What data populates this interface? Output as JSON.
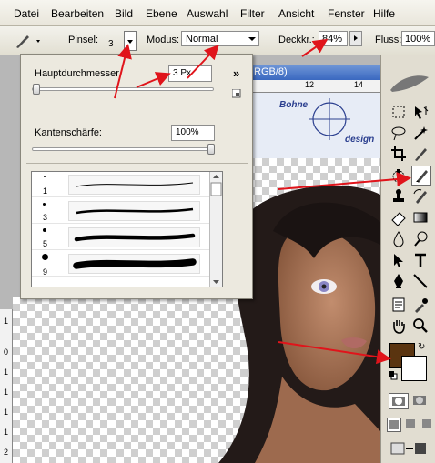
{
  "menu": [
    "Datei",
    "Bearbeiten",
    "Bild",
    "Ebene",
    "Auswahl",
    "Filter",
    "Ansicht",
    "Fenster",
    "Hilfe"
  ],
  "options": {
    "brush_label": "Pinsel:",
    "brush_size": "3",
    "mode_label": "Modus:",
    "mode_value": "Normal",
    "opacity_label": "Deckkr.:",
    "opacity_value": "84%",
    "flow_label": "Fluss:",
    "flow_value": "100%"
  },
  "document": {
    "title_fragment": "RGB/8)",
    "ruler_top_ticks": [
      "12",
      "14"
    ],
    "ruler_left_ticks": [
      "1",
      "0",
      "1",
      "1",
      "1",
      "1",
      "2"
    ],
    "logo_top": "Bohne",
    "logo_bottom": "design"
  },
  "brush_panel": {
    "diameter_label": "Hauptdurchmesser",
    "diameter_value": "3 Px",
    "hardness_label": "Kantenschärfe:",
    "hardness_value": "100%",
    "menu_glyph": "»",
    "brushes": [
      {
        "size": "1"
      },
      {
        "size": "3"
      },
      {
        "size": "5"
      },
      {
        "size": "9"
      }
    ]
  },
  "colors": {
    "foreground": "#5a3410",
    "background": "#ffffff",
    "annotation": "#e0141b"
  },
  "tools": [
    "marquee-icon",
    "move-icon",
    "lasso-icon",
    "magic-wand-icon",
    "crop-icon",
    "slice-icon",
    "healing-icon",
    "brush-icon",
    "stamp-icon",
    "history-brush-icon",
    "eraser-icon",
    "gradient-icon",
    "blur-icon",
    "dodge-icon",
    "path-select-icon",
    "type-icon",
    "pen-icon",
    "line-icon",
    "notes-icon",
    "eyedropper-icon",
    "hand-icon",
    "zoom-icon"
  ]
}
